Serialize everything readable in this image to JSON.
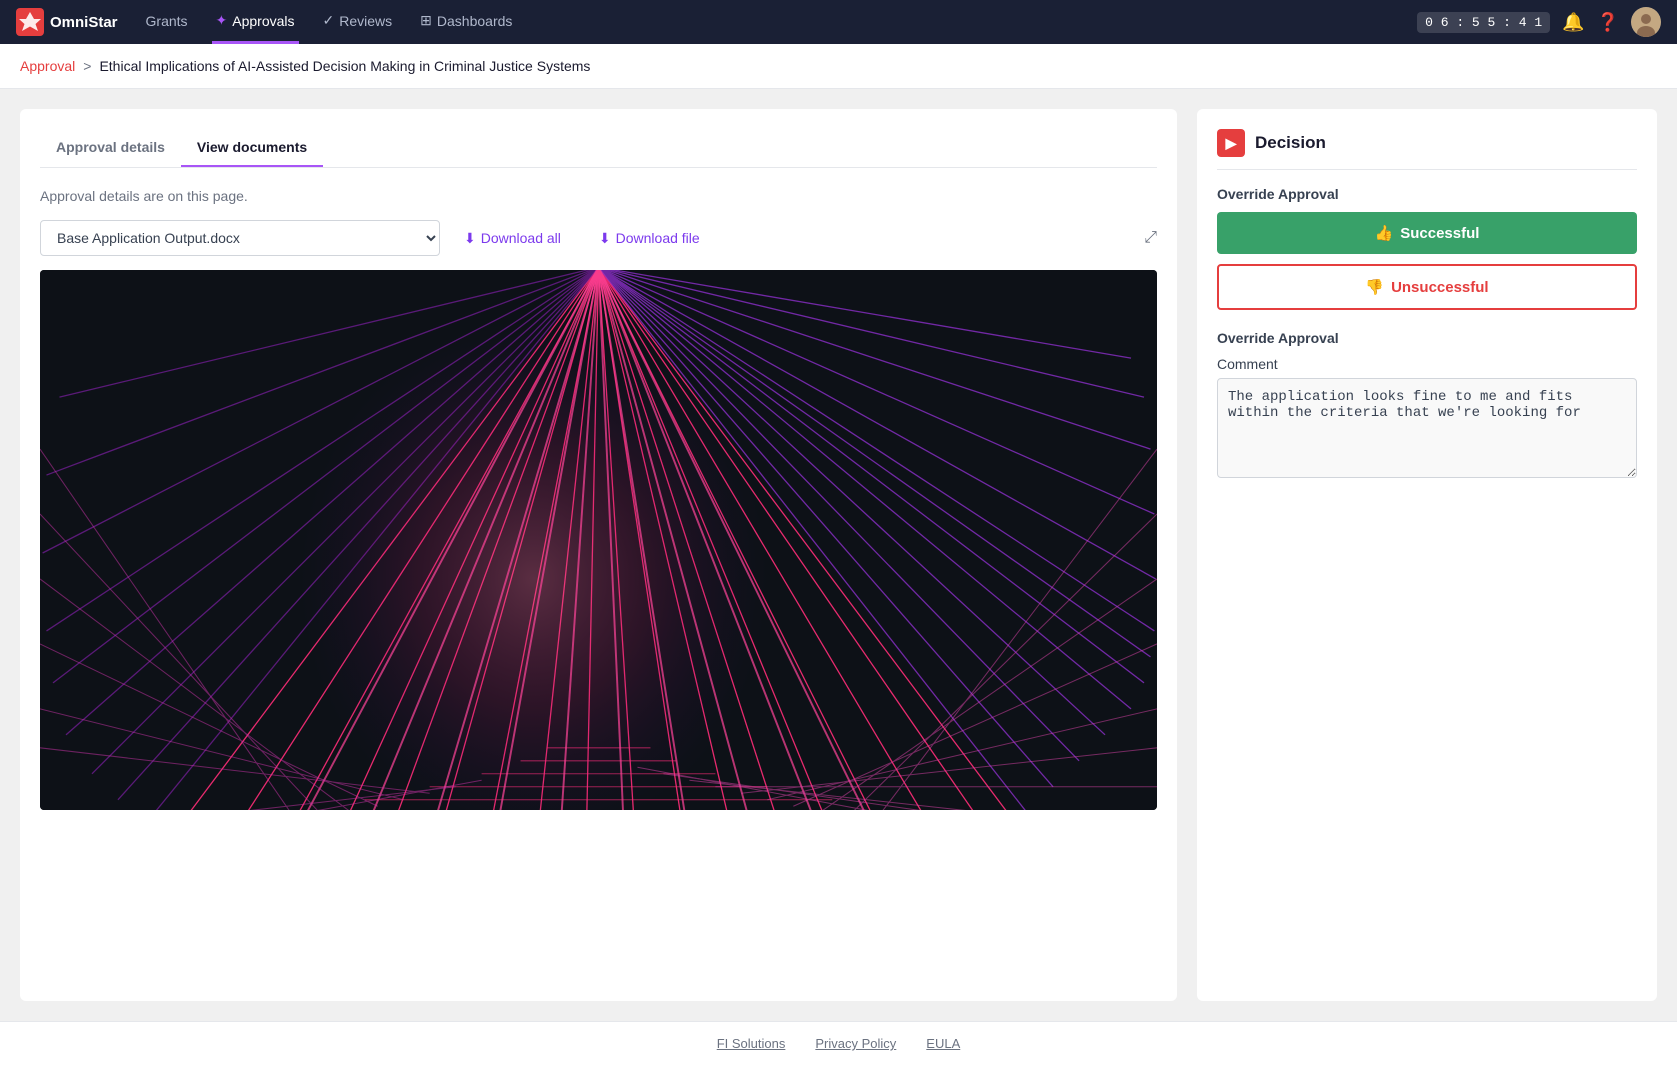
{
  "nav": {
    "brand": "OmniStar",
    "timer": "0 6 : 5 5 : 4 1",
    "items": [
      {
        "label": "Grants",
        "active": false
      },
      {
        "label": "Approvals",
        "active": true
      },
      {
        "label": "Reviews",
        "active": false
      },
      {
        "label": "Dashboards",
        "active": false
      }
    ]
  },
  "breadcrumb": {
    "link_label": "Approval",
    "separator": ">",
    "current": "Ethical Implications of AI-Assisted Decision Making in Criminal Justice Systems"
  },
  "left_panel": {
    "tabs": [
      {
        "label": "Approval details",
        "active": false
      },
      {
        "label": "View documents",
        "active": true
      }
    ],
    "tab_description": "Approval details are on this page.",
    "document_select_value": "Base Application Output.docx",
    "download_all_label": "Download all",
    "download_file_label": "Download file"
  },
  "right_panel": {
    "title": "Decision",
    "override_approval_label": "Override Approval",
    "successful_label": "Successful",
    "unsuccessful_label": "Unsuccessful",
    "override_approval_label2": "Override Approval",
    "comment_label": "Comment",
    "comment_value": "The application looks fine to me and fits within the criteria that we're looking for"
  },
  "footer": {
    "links": [
      {
        "label": "FI Solutions"
      },
      {
        "label": "Privacy Policy"
      },
      {
        "label": "EULA"
      }
    ]
  }
}
